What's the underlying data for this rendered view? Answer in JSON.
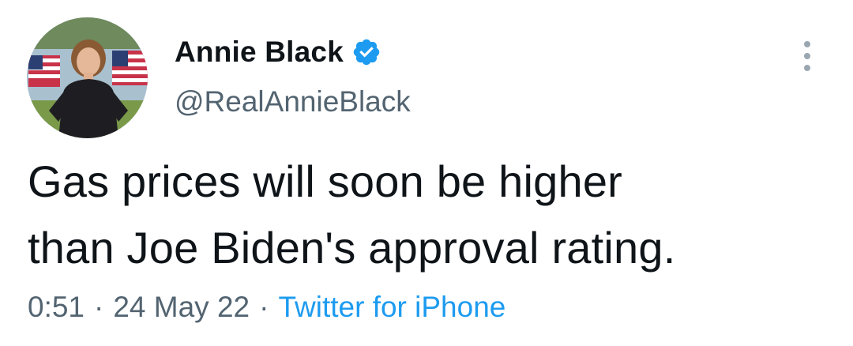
{
  "author": {
    "display_name": "Annie Black",
    "handle": "@RealAnnieBlack",
    "verified": true
  },
  "tweet": {
    "lines": [
      "Gas prices will soon be higher",
      "than Joe Biden's approval rating."
    ]
  },
  "meta": {
    "time": "0:51",
    "separator": "·",
    "date": "24 May 22",
    "source": "Twitter for iPhone"
  },
  "colors": {
    "primary_text": "#0f1419",
    "secondary_text": "#536471",
    "accent": "#1d9bf0"
  },
  "icons": {
    "verified": "verified-badge-icon",
    "more": "more-options-icon"
  }
}
